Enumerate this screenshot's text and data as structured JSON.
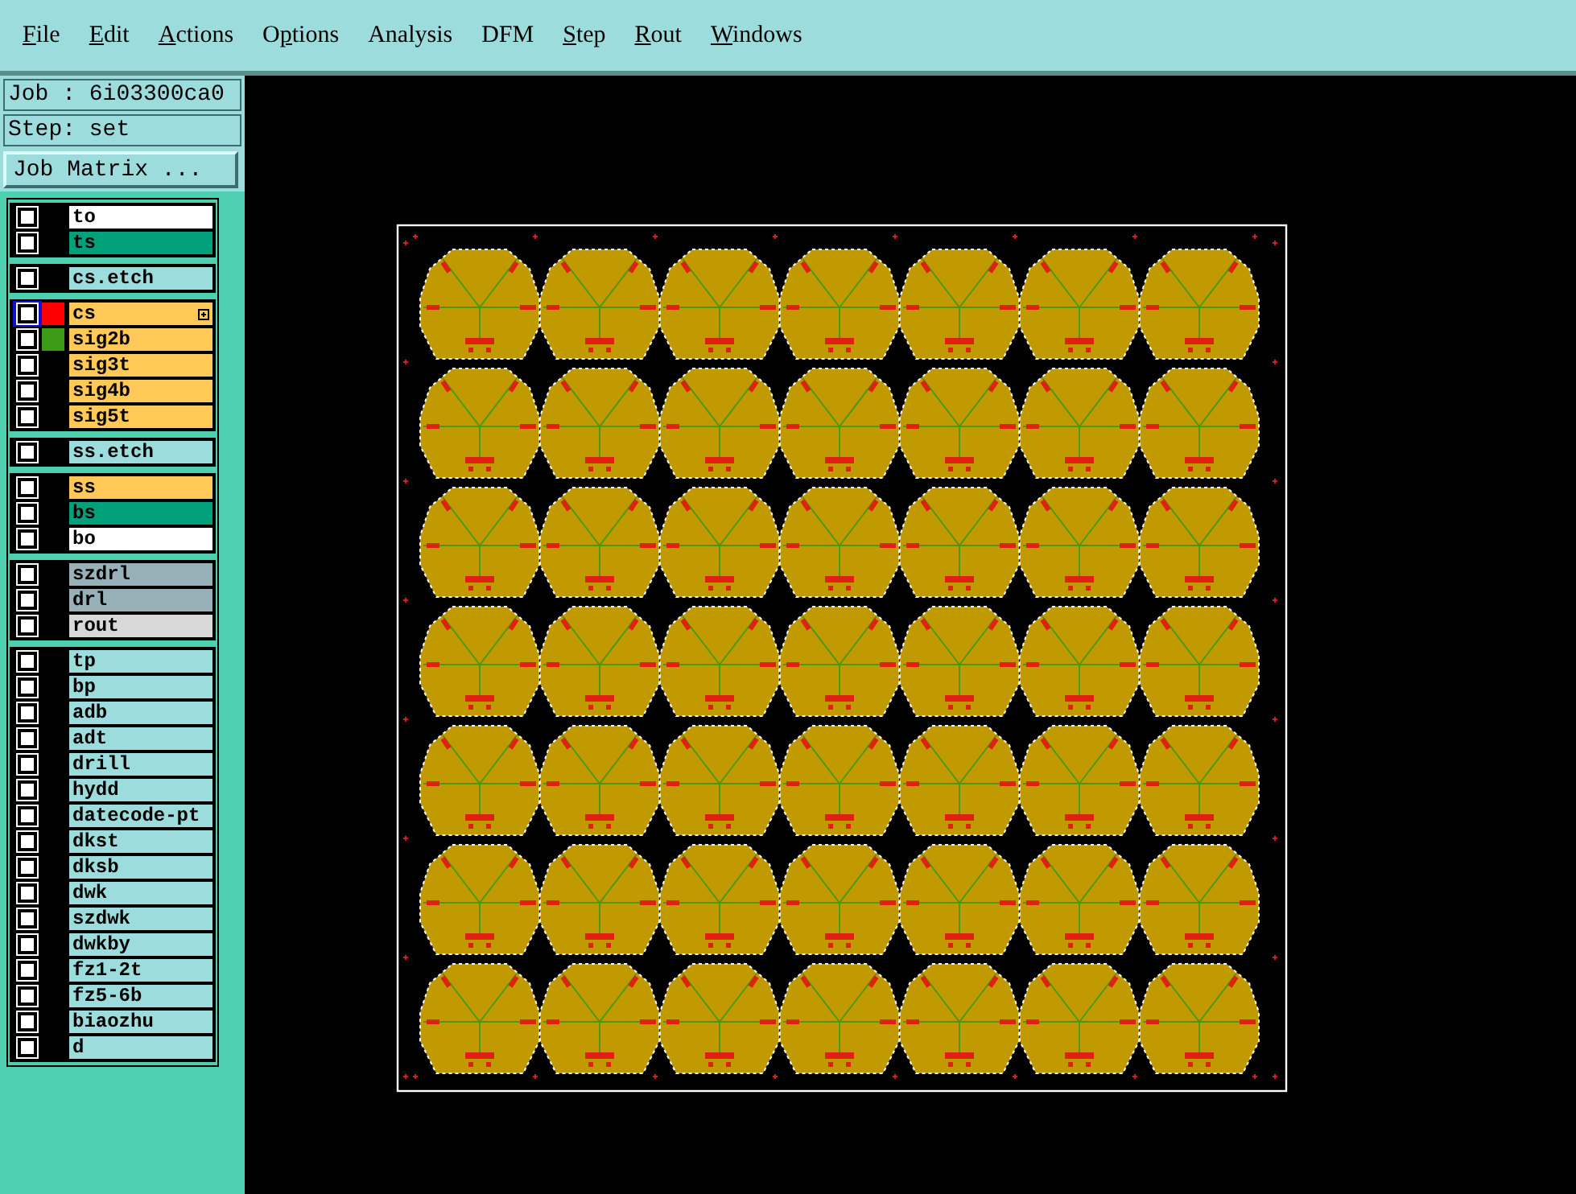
{
  "menu": [
    {
      "key": "F",
      "after": "ile"
    },
    {
      "key": "E",
      "after": "dit"
    },
    {
      "key": "A",
      "after": "ctions"
    },
    {
      "before": "O",
      "key": "p",
      "after": "tions"
    },
    {
      "before": "Analysis"
    },
    {
      "before": "DFM"
    },
    {
      "key": "S",
      "after": "tep"
    },
    {
      "key": "R",
      "after": "out"
    },
    {
      "key": "W",
      "after": "indows"
    }
  ],
  "job": {
    "label": "Job : 6i03300ca0",
    "step": "Step: set",
    "matrix_button": "Job Matrix ..."
  },
  "layer_groups": [
    {
      "layers": [
        {
          "name": "to",
          "color": "#ffffff",
          "checked": false
        },
        {
          "name": "ts",
          "color": "#00a07a",
          "checked": false
        }
      ]
    },
    {
      "layers": [
        {
          "name": "cs.etch",
          "color": "#9cdcdc",
          "checked": false
        }
      ]
    },
    {
      "layers": [
        {
          "name": "cs",
          "color": "#ffc857",
          "checked": false,
          "focused": true,
          "swatch": {
            "color": "#ff0000"
          }
        },
        {
          "name": "sig2b",
          "color": "#ffc857",
          "checked": false,
          "swatch": {
            "color": "#3c9a14"
          }
        },
        {
          "name": "sig3t",
          "color": "#ffc857",
          "checked": false
        },
        {
          "name": "sig4b",
          "color": "#ffc857",
          "checked": false
        },
        {
          "name": "sig5t",
          "color": "#ffc857",
          "checked": false
        }
      ]
    },
    {
      "layers": [
        {
          "name": "ss.etch",
          "color": "#9cdcdc",
          "checked": false
        }
      ]
    },
    {
      "layers": [
        {
          "name": "ss",
          "color": "#ffc857",
          "checked": false
        },
        {
          "name": "bs",
          "color": "#00a07a",
          "checked": false
        },
        {
          "name": "bo",
          "color": "#ffffff",
          "checked": false
        }
      ]
    },
    {
      "layers": [
        {
          "name": "szdrl",
          "color": "#98b0b8",
          "checked": false
        },
        {
          "name": "drl",
          "color": "#98b0b8",
          "checked": false
        },
        {
          "name": "rout",
          "color": "#d8d8d8",
          "checked": false
        }
      ]
    },
    {
      "layers": [
        {
          "name": "tp",
          "color": "#9cdcdc",
          "checked": false
        },
        {
          "name": "bp",
          "color": "#9cdcdc",
          "checked": false
        },
        {
          "name": "adb",
          "color": "#9cdcdc",
          "checked": false
        },
        {
          "name": "adt",
          "color": "#9cdcdc",
          "checked": false
        },
        {
          "name": "drill",
          "color": "#9cdcdc",
          "checked": false
        },
        {
          "name": "hydd",
          "color": "#9cdcdc",
          "checked": false
        },
        {
          "name": "datecode-pt",
          "color": "#9cdcdc",
          "checked": false
        },
        {
          "name": "dkst",
          "color": "#9cdcdc",
          "checked": false
        },
        {
          "name": "dksb",
          "color": "#9cdcdc",
          "checked": false
        },
        {
          "name": "dwk",
          "color": "#9cdcdc",
          "checked": false
        },
        {
          "name": "szdwk",
          "color": "#9cdcdc",
          "checked": false
        },
        {
          "name": "dwkby",
          "color": "#9cdcdc",
          "checked": false
        },
        {
          "name": "fz1-2t",
          "color": "#9cdcdc",
          "checked": false
        },
        {
          "name": "fz5-6b",
          "color": "#9cdcdc",
          "checked": false
        },
        {
          "name": "biaozhu",
          "color": "#9cdcdc",
          "checked": false
        },
        {
          "name": "d",
          "color": "#9cdcdc",
          "checked": false
        }
      ]
    }
  ]
}
